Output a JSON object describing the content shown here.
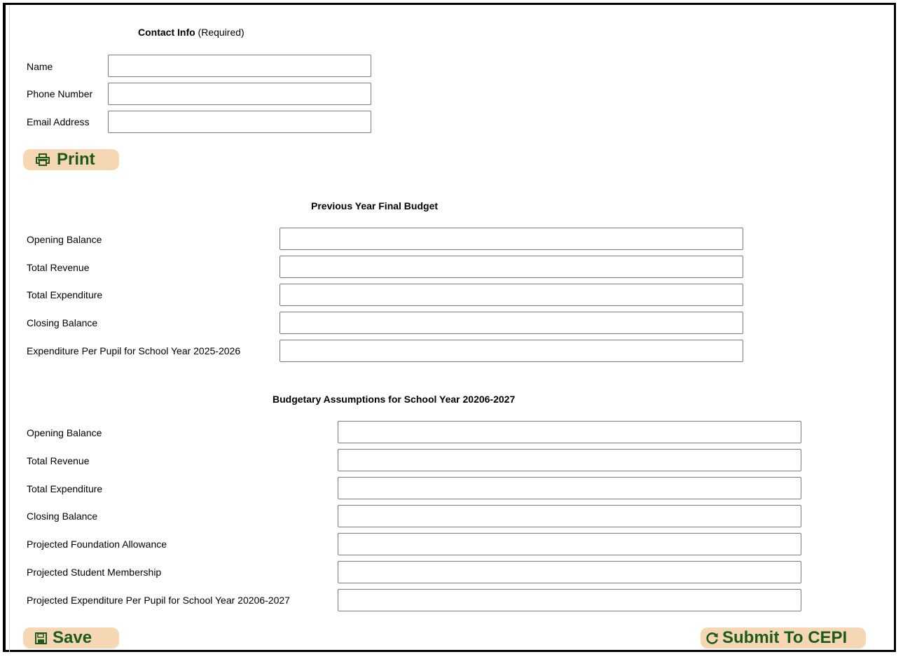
{
  "contact": {
    "title": "Contact Info",
    "required_note": "(Required)",
    "fields": [
      {
        "label": "Name",
        "value": "",
        "placeholder": ""
      },
      {
        "label": "Phone Number",
        "value": "",
        "placeholder": ""
      },
      {
        "label": "Email Address",
        "value": "",
        "placeholder": ""
      }
    ]
  },
  "print_button": {
    "label": "Print",
    "icon": "printer-icon"
  },
  "previous_year": {
    "title": "Previous Year Final Budget",
    "fields": [
      {
        "label": "Opening Balance",
        "value": ""
      },
      {
        "label": "Total Revenue",
        "value": ""
      },
      {
        "label": "Total Expenditure",
        "value": ""
      },
      {
        "label": "Closing Balance",
        "value": ""
      },
      {
        "label": "Expenditure Per Pupil for School Year 2025-2026",
        "value": ""
      }
    ]
  },
  "assumptions": {
    "title": "Budgetary Assumptions for School Year 20206-2027",
    "fields": [
      {
        "label": "Opening Balance",
        "value": ""
      },
      {
        "label": "Total Revenue",
        "value": ""
      },
      {
        "label": "Total Expenditure",
        "value": ""
      },
      {
        "label": "Closing Balance",
        "value": ""
      },
      {
        "label": "Projected Foundation Allowance",
        "value": ""
      },
      {
        "label": "Projected Student Membership",
        "value": ""
      },
      {
        "label": "Projected Expenditure Per Pupil for School Year 20206-2027",
        "value": ""
      }
    ]
  },
  "save_button": {
    "label": "Save",
    "icon": "floppy-disk-icon"
  },
  "submit_button": {
    "label": "Submit To CEPI",
    "icon": "circular-arrow-icon"
  },
  "colors": {
    "button_bg": "#f5d7b4",
    "button_text": "#1e5a1e",
    "border": "#000000"
  }
}
